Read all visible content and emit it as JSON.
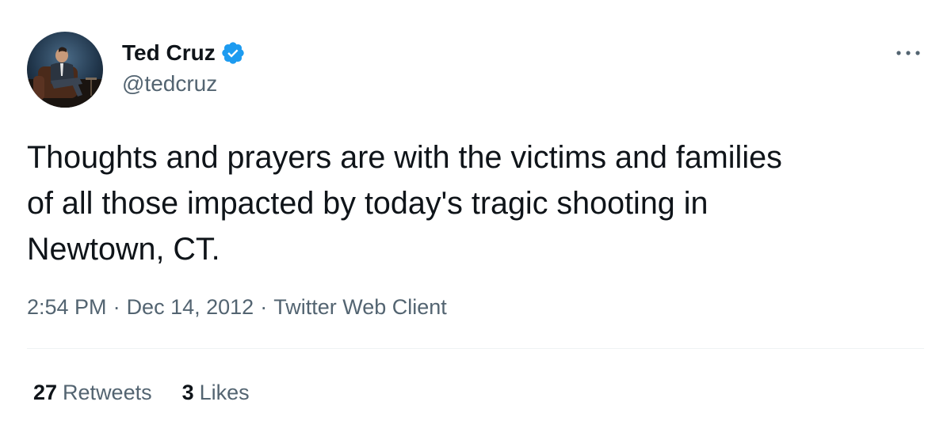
{
  "user": {
    "display_name": "Ted Cruz",
    "handle": "@tedcruz",
    "verified_icon": "verified-badge-icon",
    "avatar_icon": "profile-photo"
  },
  "more_icon": "more-horizontal-icon",
  "tweet": {
    "text": "Thoughts and prayers are with the victims and families\nof all those impacted by today's tragic shooting in\nNewtown, CT."
  },
  "meta": {
    "time": "2:54 PM",
    "separator": "·",
    "date": "Dec 14, 2012",
    "source": "Twitter Web Client"
  },
  "stats": {
    "retweets_count": "27",
    "retweets_label": "Retweets",
    "likes_count": "3",
    "likes_label": "Likes"
  },
  "colors": {
    "text_primary": "#0f1419",
    "text_secondary": "#536471",
    "verified_blue": "#1d9bf0",
    "divider": "#eff3f4"
  }
}
